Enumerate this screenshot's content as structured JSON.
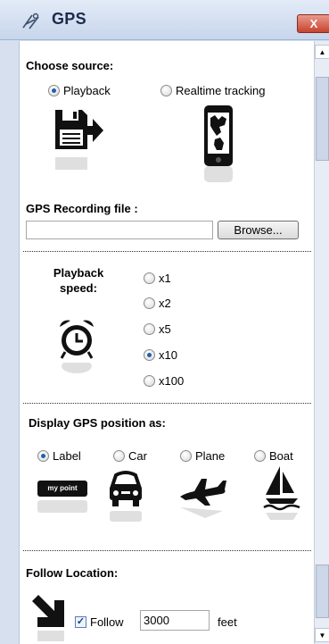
{
  "window": {
    "title": "GPS",
    "close_label": "X"
  },
  "source": {
    "title": "Choose source:",
    "options": [
      {
        "label": "Playback",
        "selected": true,
        "icon": "floppy-arrow-icon"
      },
      {
        "label": "Realtime tracking",
        "selected": false,
        "icon": "phone-map-icon"
      }
    ]
  },
  "recording": {
    "title": "GPS Recording file :",
    "value": "",
    "browse_label": "Browse..."
  },
  "speed": {
    "title_line1": "Playback",
    "title_line2": "speed:",
    "icon": "alarm-clock-icon",
    "options": [
      {
        "label": "x1",
        "selected": false
      },
      {
        "label": "x2",
        "selected": false
      },
      {
        "label": "x5",
        "selected": false
      },
      {
        "label": "x10",
        "selected": true
      },
      {
        "label": "x100",
        "selected": false
      }
    ]
  },
  "display": {
    "title": "Display GPS position as:",
    "options": [
      {
        "label": "Label",
        "selected": true,
        "icon": "label-icon",
        "icon_text": "my point"
      },
      {
        "label": "Car",
        "selected": false,
        "icon": "car-icon"
      },
      {
        "label": "Plane",
        "selected": false,
        "icon": "plane-icon"
      },
      {
        "label": "Boat",
        "selected": false,
        "icon": "boat-icon"
      }
    ]
  },
  "follow": {
    "title": "Follow Location:",
    "icon": "arrow-down-right-icon",
    "checkbox_label": "Follow",
    "checked": true,
    "distance_value": "3000",
    "unit": "feet"
  },
  "colors": {
    "chrome": "#d6e0ef",
    "accent": "#1f5fb0",
    "close": "#c6442e"
  }
}
